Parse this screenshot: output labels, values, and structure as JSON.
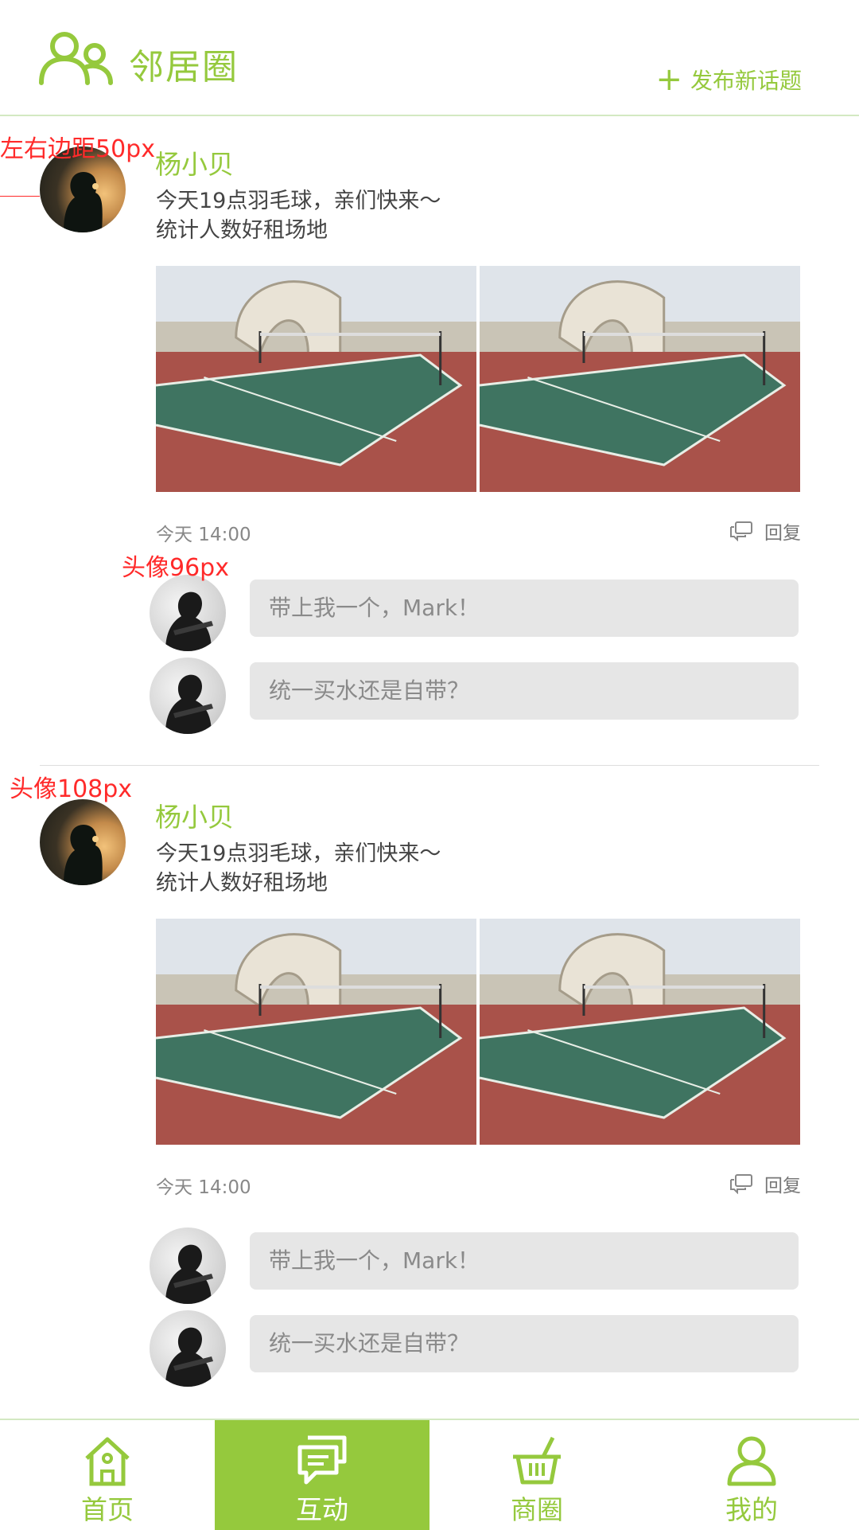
{
  "header": {
    "title": "邻居圈",
    "new_topic_label": "发布新话题",
    "people_icon": "people-icon",
    "plus_icon": "plus-icon"
  },
  "annotations": {
    "margin_note": "左右边距50px",
    "comment_avatar_note": "头像96px",
    "post_avatar_note": "头像108px"
  },
  "posts": [
    {
      "username": "杨小贝",
      "content_line1": "今天19点羽毛球，亲们快来～",
      "content_line2": "统计人数好租场地",
      "timestamp": "今天 14:00",
      "reply_label": "回复",
      "comments": [
        {
          "text": "带上我一个，Mark！"
        },
        {
          "text": "统一买水还是自带？"
        }
      ]
    },
    {
      "username": "杨小贝",
      "content_line1": "今天19点羽毛球，亲们快来～",
      "content_line2": "统计人数好租场地",
      "timestamp": "今天 14:00",
      "reply_label": "回复",
      "comments": [
        {
          "text": "带上我一个，Mark！"
        },
        {
          "text": "统一买水还是自带？"
        }
      ]
    }
  ],
  "tabbar": {
    "active_index": 1,
    "tabs": [
      {
        "label": "首页",
        "icon": "home-icon"
      },
      {
        "label": "互动",
        "icon": "chat-icon"
      },
      {
        "label": "商圈",
        "icon": "basket-icon"
      },
      {
        "label": "我的",
        "icon": "user-icon"
      }
    ]
  },
  "colors": {
    "accent": "#95c93d",
    "annotation": "#ff2a2a",
    "bubble_bg": "#e6e6e6"
  }
}
